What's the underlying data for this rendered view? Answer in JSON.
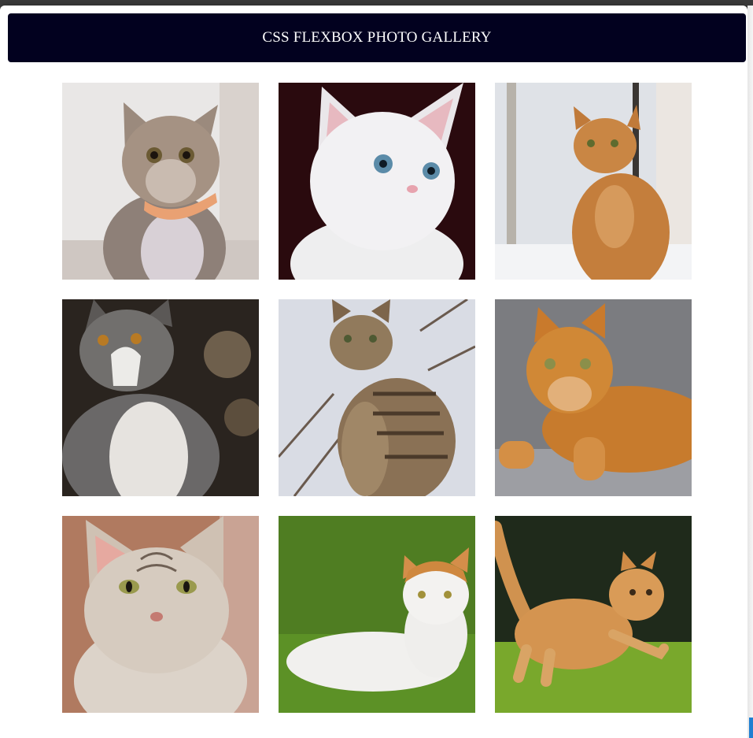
{
  "header": {
    "title": "CSS FLEXBOX PHOTO GALLERY"
  },
  "colors": {
    "header_bg": "#02011f",
    "header_text": "#ffffff",
    "page_bg": "#ffffff",
    "accent": "#1f7fd1"
  },
  "gallery": {
    "photos": [
      {
        "subject": "tabby-cat-with-collar"
      },
      {
        "subject": "white-kitten"
      },
      {
        "subject": "orange-cat-by-window"
      },
      {
        "subject": "gray-white-cat-outdoors"
      },
      {
        "subject": "striped-tabby-cat-sitting"
      },
      {
        "subject": "orange-cat-lying-on-couch"
      },
      {
        "subject": "silver-tabby-closeup"
      },
      {
        "subject": "white-orange-cat-on-grass"
      },
      {
        "subject": "orange-kitten-running"
      }
    ]
  }
}
